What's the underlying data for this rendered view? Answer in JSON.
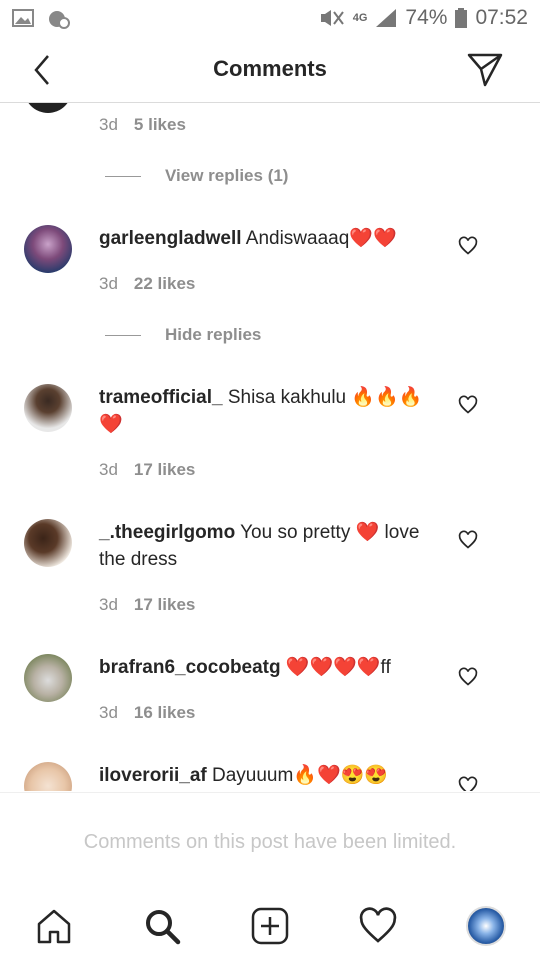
{
  "status_bar": {
    "battery": "74%",
    "time": "07:52",
    "network": "4G"
  },
  "header": {
    "title": "Comments"
  },
  "comments": [
    {
      "meta_time": "3d",
      "likes": "5 likes"
    },
    {
      "username": "garleengladwell",
      "text": "Andiswaaaq❤️❤️",
      "meta_time": "3d",
      "likes": "22 likes"
    },
    {
      "username": "trameofficial_",
      "text": "Shisa kakhulu 🔥🔥🔥❤️",
      "meta_time": "3d",
      "likes": "17 likes"
    },
    {
      "username": "_.theegirlgomo",
      "text": "You so pretty ❤️ love the dress",
      "meta_time": "3d",
      "likes": "17 likes"
    },
    {
      "username": "brafran6_cocobeatg",
      "text": "❤️❤️❤️❤️ff",
      "meta_time": "3d",
      "likes": "16 likes"
    },
    {
      "username": "iloverorii_af",
      "text": "Dayuuum🔥❤️😍😍"
    }
  ],
  "replies": {
    "view": "View replies (1)",
    "hide": "Hide replies"
  },
  "footer": {
    "limited_notice": "Comments on this post have been limited."
  },
  "icons": {
    "nav": [
      "home-icon",
      "search-icon",
      "new-post-icon",
      "activity-heart-icon",
      "profile-avatar"
    ]
  }
}
